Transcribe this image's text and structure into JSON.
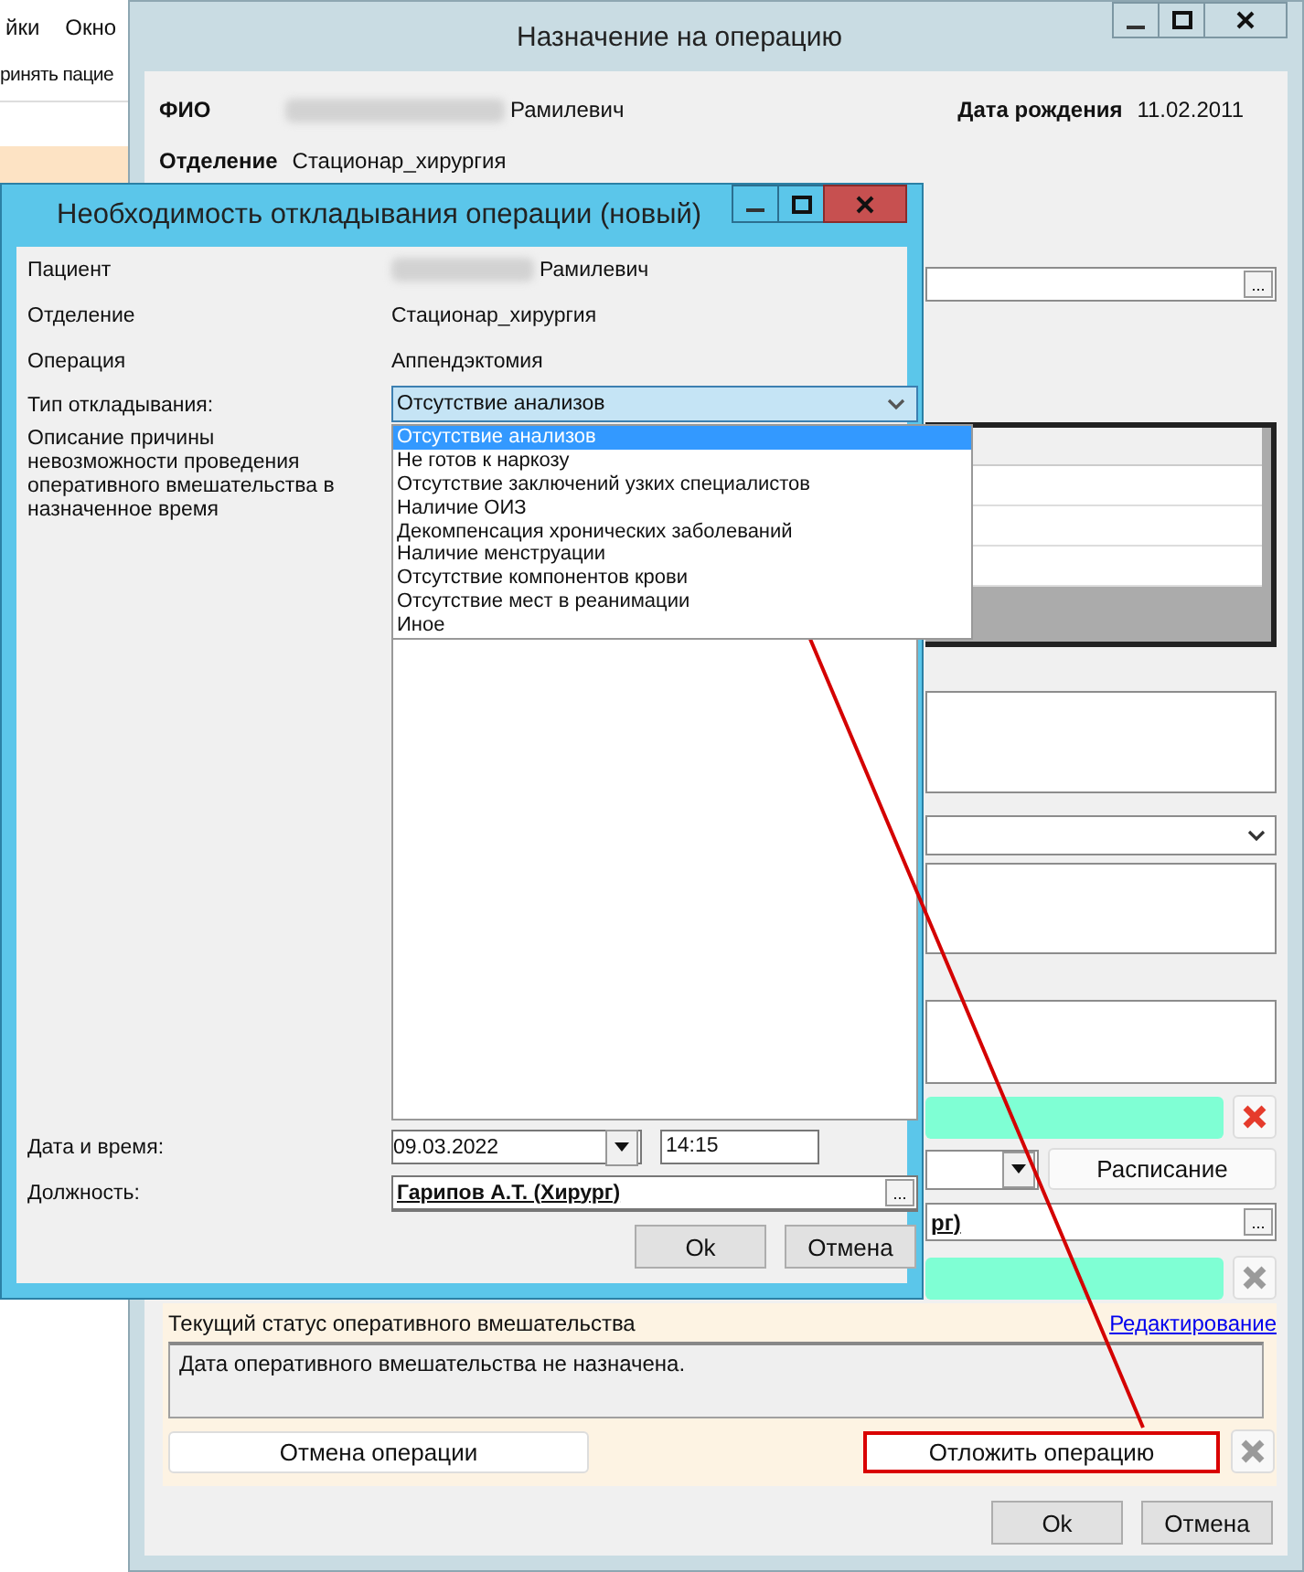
{
  "background_app": {
    "menu": [
      "йки",
      "Окно"
    ],
    "toolbar_button": "ринять пацие"
  },
  "main_window": {
    "title": "Назначение на операцию",
    "patient": {
      "label": "ФИО",
      "value": "Рамилевич",
      "redacted": true
    },
    "birth_date": {
      "label": "Дата рождения",
      "value": "11.02.2011"
    },
    "department": {
      "label": "Отделение",
      "value": "Стационар_хирургия"
    },
    "browse_buttons": [
      "...",
      "..."
    ],
    "schedule_button": "Расписание",
    "surgeon_fragment": "рг)",
    "status": {
      "title": "Текущий статус оперативного вмешательства",
      "edit_link": "Редактирование",
      "text": "Дата оперативного вмешательства не назначена.",
      "cancel_button": "Отмена операции",
      "postpone_button": {
        "label": "Отложить операцию",
        "highlighted": true
      }
    },
    "buttons": [
      "Ok",
      "Отмена"
    ]
  },
  "dialog": {
    "title": "Необходимость откладывания операции (новый)",
    "rows": [
      {
        "label": "Пациент",
        "value": "Рамилевич",
        "redacted": true
      },
      {
        "label": "Отделение",
        "value": "Стационар_хирургия",
        "redacted": false
      },
      {
        "label": "Операция",
        "value": "Аппендэктомия",
        "redacted": false
      }
    ],
    "postpone_type": {
      "label": "Тип откладывания:",
      "value": "Отсутствие анализов",
      "expanded": true,
      "options": [
        {
          "label": "Отсутствие анализов",
          "selected": true
        },
        {
          "label": "Не готов к наркозу",
          "selected": false
        },
        {
          "label": "Отсутствие заключений узких специалистов",
          "selected": false
        },
        {
          "label": "Наличие ОИЗ",
          "selected": false
        },
        {
          "label": "Декомпенсация хронических заболеваний",
          "selected": false
        },
        {
          "label": "Наличие менструации",
          "selected": false
        },
        {
          "label": "Отсутствие компонентов крови",
          "selected": false
        },
        {
          "label": "Отсутствие мест в реанимации",
          "selected": false
        },
        {
          "label": "Иное",
          "selected": false
        }
      ]
    },
    "description_label": "Описание причины невозможности проведения оперативного вмешательства в назначенное время",
    "date_time": {
      "label": "Дата и время:",
      "date": "09.03.2022",
      "time": "14:15"
    },
    "position": {
      "label": "Должность:",
      "value": "Гарипов А.Т. (Хирург)",
      "browse_button": "..."
    },
    "buttons": [
      "Ok",
      "Отмена"
    ]
  }
}
